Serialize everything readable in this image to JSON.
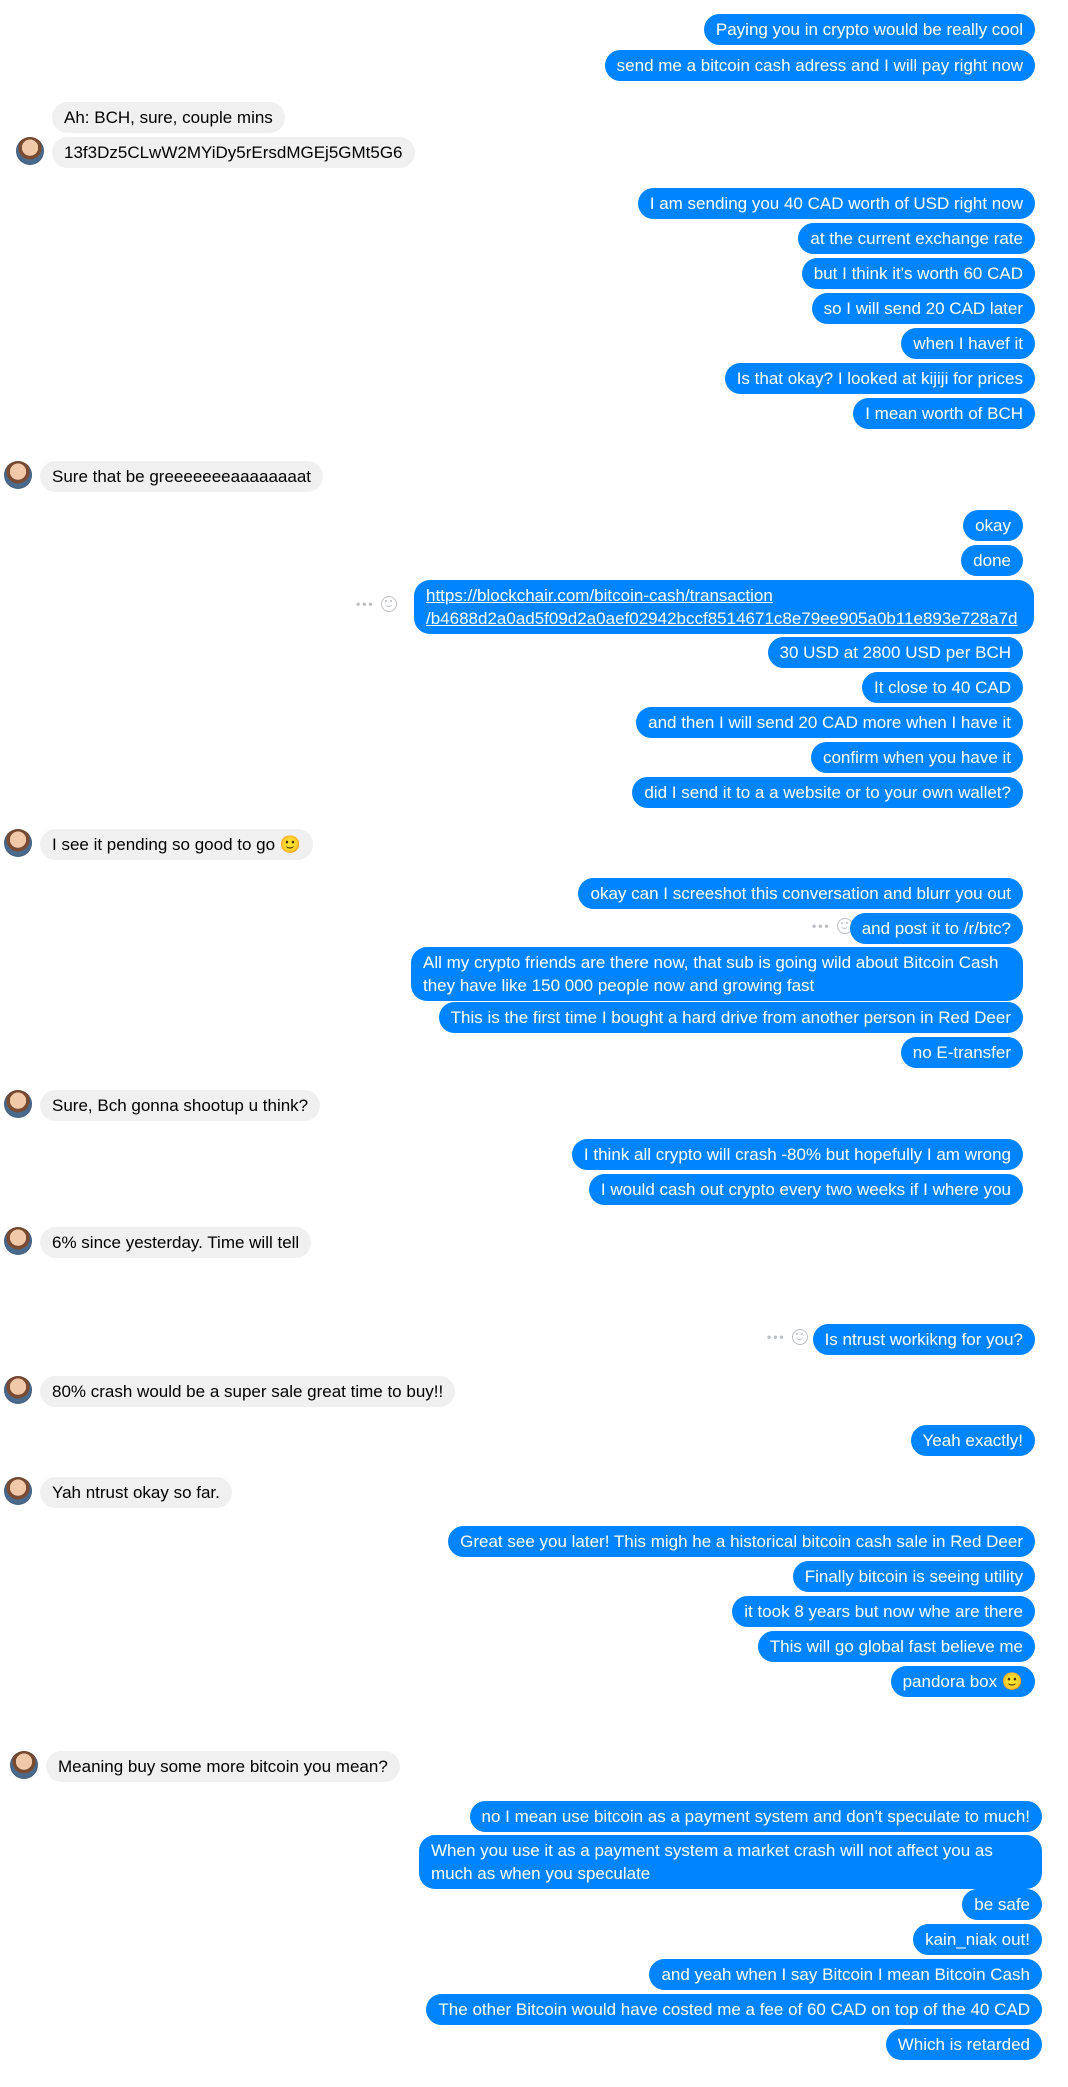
{
  "messages": {
    "m1": "Paying you in crypto would be really cool",
    "m2": "send me a bitcoin cash adress and I will pay right now",
    "m3": "Ah: BCH, sure, couple mins",
    "m4": "13f3Dz5CLwW2MYiDy5rErsdMGEj5GMt5G6",
    "m5": "I am sending you 40 CAD worth of USD right now",
    "m6": "at the current exchange rate",
    "m7": "but I think it's worth 60 CAD",
    "m8": "so I will send 20 CAD later",
    "m9": "when I havef it",
    "m10": "Is that okay? I looked at kijiji for prices",
    "m11": "I mean worth of BCH",
    "m12": "Sure that be greeeeeeeaaaaaaaat",
    "m13": "okay",
    "m14": "done",
    "m15a": "https://blockchair.com/bitcoin-cash/transaction",
    "m15b": "/b4688d2a0ad5f09d2a0aef02942bccf8514671c8e79ee905a0b11e893e728a7d",
    "m16": "30 USD at 2800 USD per BCH",
    "m17": "It close to 40 CAD",
    "m18": "and then I will send 20 CAD more when I have it",
    "m19": "confirm when you have it",
    "m20": "did I send it to a a website or to your own wallet?",
    "m21": "I see it pending so good to go 🙂",
    "m22": "okay can I screeshot this conversation and blurr you out",
    "m23": "and post it to /r/btc?",
    "m24": "All my crypto friends are there now, that sub is going wild about Bitcoin Cash they have like 150 000 people now and growing fast",
    "m25": "This is the first time I bought a hard drive from another person in Red Deer",
    "m26": "no E-transfer",
    "m27": "Sure, Bch gonna shootup u think?",
    "m28": "I think all crypto will crash -80% but hopefully I am wrong",
    "m29": "I would cash out crypto every two weeks if  I where you",
    "m30": "6% since yesterday. Time will tell",
    "m31": "Is ntrust workikng for you?",
    "m32": "80% crash would be a super sale great time to buy!!",
    "m33": "Yeah exactly!",
    "m34": "Yah ntrust okay so far.",
    "m35": "Great see you later! This migh he a historical bitcoin cash sale in Red Deer",
    "m36": "Finally bitcoin is seeing utility",
    "m37": "it took 8 years but now whe are there",
    "m38": "This will go global fast believe me",
    "m39": "pandora box 🙂",
    "m40": "Meaning buy some more bitcoin you mean?",
    "m41": "no I mean use bitcoin as a payment system and don't speculate to much!",
    "m42": "When you use it as a payment system a market crash will not affect you as much as when you speculate",
    "m43": "be safe",
    "m44": "kain_niak out!",
    "m45": "and yeah when I say Bitcoin I mean Bitcoin Cash",
    "m46": "The other Bitcoin would have costed me a fee of 60 CAD on top of the 40 CAD",
    "m47": "Which is retarded"
  },
  "icons": {
    "avatar": "contact-avatar",
    "more": "more-options-icon",
    "react": "emoji-reaction-icon"
  },
  "colors": {
    "outgoing_bubble": "#0084ff",
    "incoming_bubble": "#f1f0f0",
    "outgoing_text": "#ffffff",
    "incoming_text": "#000000"
  }
}
